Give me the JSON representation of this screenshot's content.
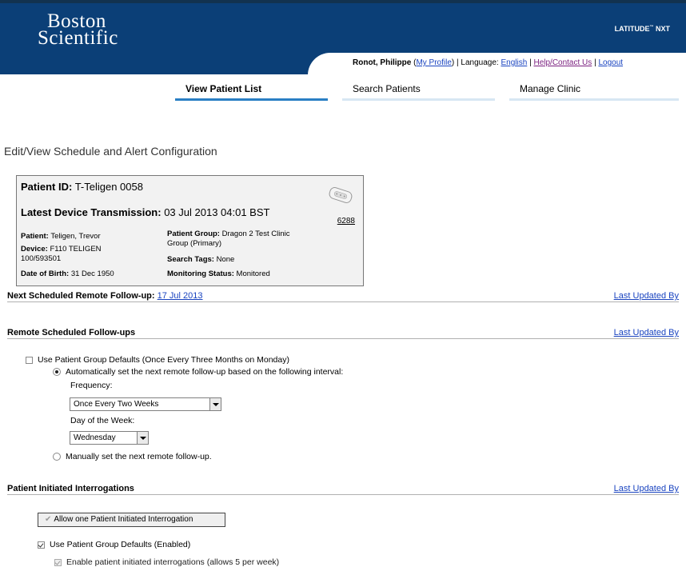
{
  "header": {
    "logo_line1": "Boston",
    "logo_line2": "Scientific",
    "brand": "LATITUDE",
    "brand_tm": "™",
    "brand_suffix": " NXT",
    "user_name": "Ronot, Philippe",
    "my_profile": "My Profile",
    "language_label": "Language:",
    "language_value": "English",
    "help": "Help/Contact Us",
    "logout": "Logout",
    "sep": "|",
    "paren_open": "(",
    "paren_close": ")"
  },
  "nav": {
    "tabs": [
      {
        "label": "View Patient List",
        "active": true
      },
      {
        "label": "Search Patients",
        "active": false
      },
      {
        "label": "Manage Clinic",
        "active": false
      }
    ]
  },
  "page_title": "Edit/View Schedule and Alert Configuration",
  "patient_card": {
    "patient_id_label": "Patient ID:",
    "patient_id": "T-Teligen 0058",
    "ldt_label": "Latest Device Transmission:",
    "ldt_value": "03 Jul 2013 04:01 BST",
    "device_number": "6288",
    "patient_label": "Patient:",
    "patient_value": "Teligen, Trevor",
    "device_label": "Device:",
    "device_value_1": "F110 TELIGEN",
    "device_value_2": "100/593501",
    "dob_label": "Date of Birth:",
    "dob_value": "31 Dec 1950",
    "group_label": "Patient Group:",
    "group_value_1": "Dragon 2 Test Clinic",
    "group_value_2": "Group (Primary)",
    "tags_label": "Search Tags:",
    "tags_value": "None",
    "monitoring_label": "Monitoring Status:",
    "monitoring_value": "Monitored"
  },
  "next_followup": {
    "label": "Next Scheduled Remote Follow-up:",
    "date": "17 Jul 2013",
    "last_updated": "Last Updated By"
  },
  "remote_followups": {
    "title": "Remote Scheduled Follow-ups",
    "last_updated": "Last Updated By",
    "use_defaults_label": "Use Patient Group Defaults (Once Every Three Months on Monday)",
    "use_defaults_checked": false,
    "auto_label": "Automatically set the next remote follow-up based on the following interval:",
    "auto_selected": true,
    "frequency_label": "Frequency:",
    "frequency_value": "Once Every Two Weeks",
    "day_label": "Day of the Week:",
    "day_value": "Wednesday",
    "manual_label": "Manually set the next remote follow-up.",
    "manual_selected": false
  },
  "pii": {
    "title": "Patient Initiated Interrogations",
    "last_updated": "Last Updated By",
    "button_label": "Allow one Patient Initiated Interrogation",
    "use_defaults_label": "Use Patient Group Defaults (Enabled)",
    "use_defaults_checked": true,
    "enable_label": "Enable patient initiated interrogations (allows 5 per week)",
    "enable_checked": true
  },
  "colors": {
    "header_bg": "#0b3f77",
    "nav_active": "#2a7fc4",
    "link": "#1a44c0",
    "visited_link": "#7a1f7f"
  }
}
